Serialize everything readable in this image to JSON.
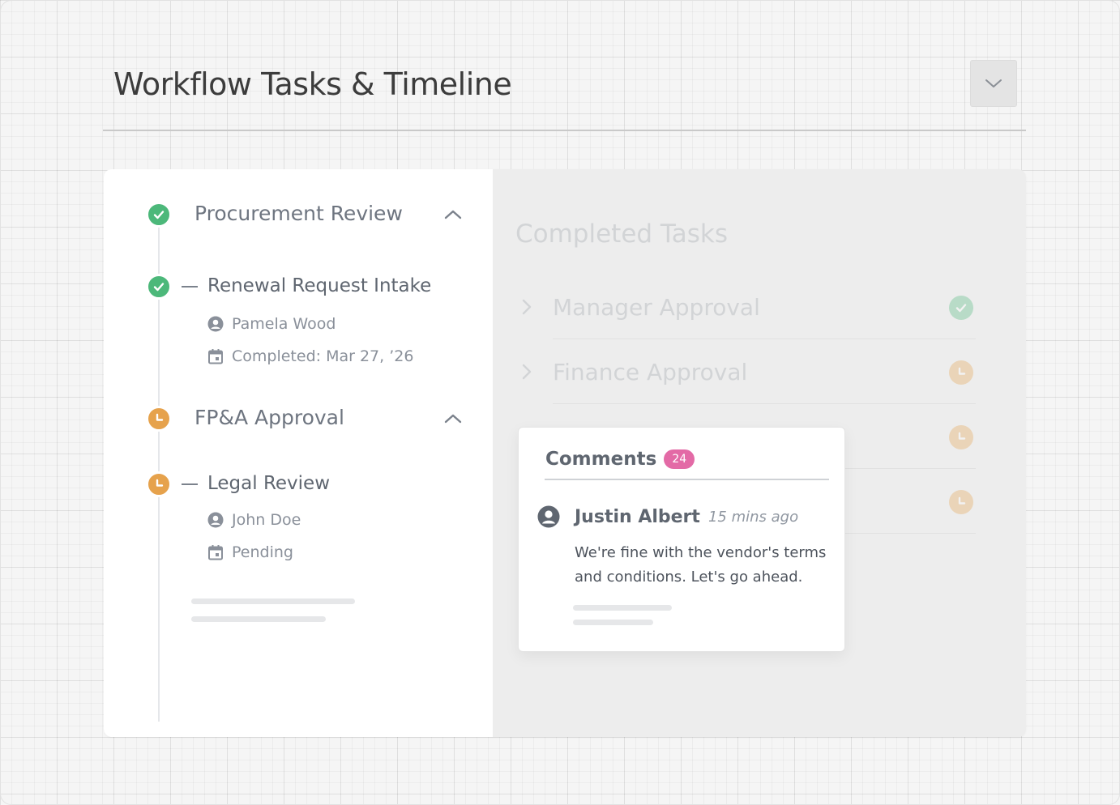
{
  "header": {
    "title": "Workflow Tasks & Timeline",
    "collapse_icon": "chevron-down-icon"
  },
  "timeline": {
    "groups": [
      {
        "title": "Procurement Review",
        "status": "completed",
        "status_color": "#4cb87a",
        "task": {
          "title": "Renewal Request Intake",
          "status": "completed",
          "assignee": "Pamela Wood",
          "date": "Completed: Mar 27, ’26"
        }
      },
      {
        "title": "FP&A Approval",
        "status": "pending",
        "status_color": "#e6a24c",
        "task": {
          "title": "Legal Review",
          "status": "pending",
          "assignee": "John Doe",
          "date": "Pending"
        }
      }
    ]
  },
  "completed_tasks": {
    "title": "Completed Tasks",
    "items": [
      {
        "label": "Manager Approval",
        "status": "completed"
      },
      {
        "label": "Finance Approval",
        "status": "pending"
      }
    ]
  },
  "comments": {
    "title": "Comments",
    "count": "24",
    "badge_color": "#e36aa6",
    "latest": {
      "author": "Justin Albert",
      "time": "15 mins ago",
      "text": "We're fine with the vendor's terms and conditions. Let's go ahead."
    }
  }
}
